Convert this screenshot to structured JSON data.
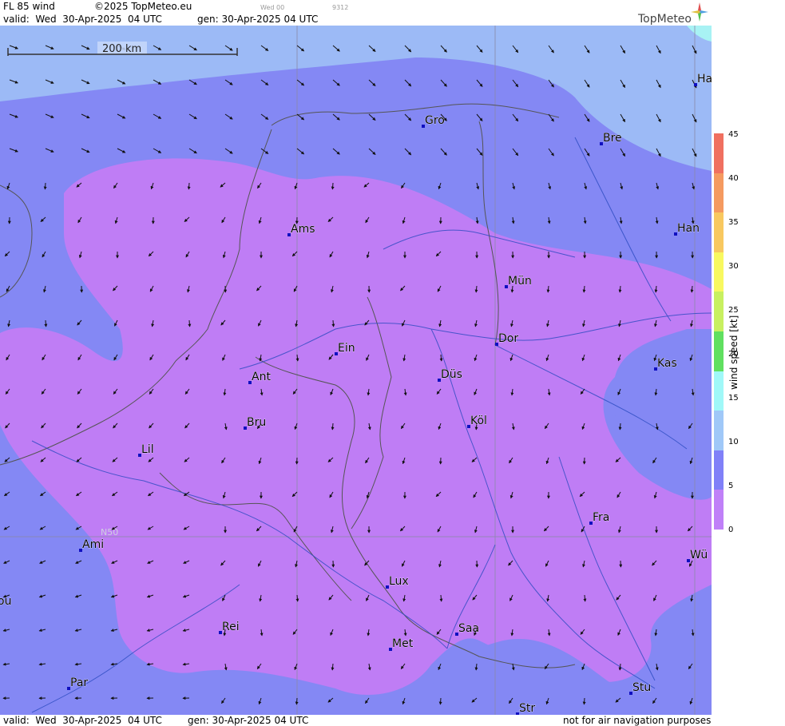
{
  "header": {
    "product": "FL 85 wind",
    "copyright": "©2025 TopMeteo.eu",
    "day_code": "Wed 00",
    "code": "9312",
    "valid": "valid:  Wed  30-Apr-2025  04 UTC",
    "generated": "gen: 30-Apr-2025 04 UTC",
    "logo": "TopMeteo"
  },
  "footer": {
    "valid": "valid:  Wed  30-Apr-2025  04 UTC",
    "generated": "gen: 30-Apr-2025 04 UTC",
    "disclaimer": "not for air navigation purposes"
  },
  "map": {
    "scale_bar_label": "200 km",
    "graticule_label": "N50",
    "cities": [
      {
        "label": "Ha"
      },
      {
        "label": "Gro"
      },
      {
        "label": "Bre"
      },
      {
        "label": "Ams"
      },
      {
        "label": "Han"
      },
      {
        "label": "Mün"
      },
      {
        "label": "Dor"
      },
      {
        "label": "Ein"
      },
      {
        "label": "Kas"
      },
      {
        "label": "Ant"
      },
      {
        "label": "Düs"
      },
      {
        "label": "Bru"
      },
      {
        "label": "Köl"
      },
      {
        "label": "Lil"
      },
      {
        "label": "Fra"
      },
      {
        "label": "Ami"
      },
      {
        "label": "Wü"
      },
      {
        "label": "Lux"
      },
      {
        "label": "ou"
      },
      {
        "label": "Rei"
      },
      {
        "label": "Saa"
      },
      {
        "label": "Met"
      },
      {
        "label": "Par"
      },
      {
        "label": "Stu"
      },
      {
        "label": "Str"
      }
    ]
  },
  "legend": {
    "title": "wind  speed  [kt]",
    "ticks": [
      "45",
      "40",
      "35",
      "30",
      "25",
      "20",
      "15",
      "10",
      "5",
      "0"
    ],
    "colors": [
      "#f07060",
      "#f59a60",
      "#f8c860",
      "#f8f860",
      "#c8f060",
      "#60e060",
      "#a0f8f8",
      "#a0c8f8",
      "#8080f8",
      "#c080f8"
    ]
  }
}
